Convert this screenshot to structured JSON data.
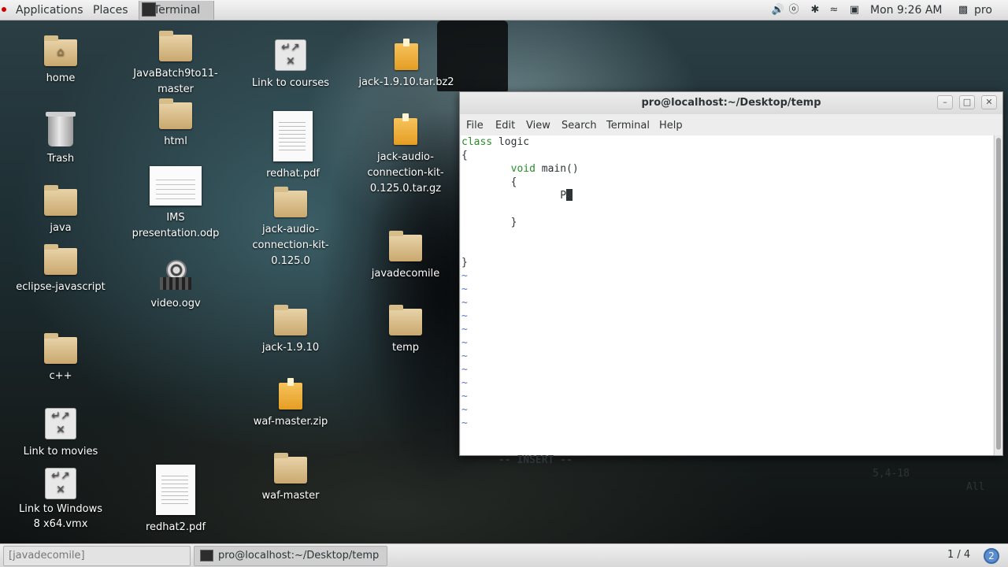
{
  "top_panel": {
    "applications": "Applications",
    "places": "Places",
    "terminal_launcher": "Terminal",
    "clock": "Mon  9:26 AM",
    "user": "pro",
    "tray_icons": [
      "volume-icon",
      "headset-icon",
      "bluetooth-icon",
      "wifi-icon",
      "clipboard-icon"
    ]
  },
  "desktop": {
    "icons": [
      {
        "label": "home",
        "type": "home-folder"
      },
      {
        "label": "Trash",
        "type": "trash"
      },
      {
        "label": "java",
        "type": "folder"
      },
      {
        "label": "eclipse-javascript",
        "type": "folder"
      },
      {
        "label": "c++",
        "type": "folder"
      },
      {
        "label": "Link to movies",
        "type": "link"
      },
      {
        "label": "Link to Windows 8 x64.vmx",
        "type": "link"
      },
      {
        "label": "JavaBatch9to11-master",
        "type": "folder"
      },
      {
        "label": "html",
        "type": "folder"
      },
      {
        "label": "IMS presentation.odp",
        "type": "presentation"
      },
      {
        "label": "video.ogv",
        "type": "video"
      },
      {
        "label": "redhat2.pdf",
        "type": "document"
      },
      {
        "label": "Link to courses",
        "type": "link"
      },
      {
        "label": "redhat.pdf",
        "type": "document"
      },
      {
        "label": "jack-audio-connection-kit-0.125.0",
        "type": "folder"
      },
      {
        "label": "jack-1.9.10",
        "type": "folder"
      },
      {
        "label": "waf-master.zip",
        "type": "archive"
      },
      {
        "label": "waf-master",
        "type": "folder"
      },
      {
        "label": "jack-1.9.10.tar.bz2",
        "type": "archive"
      },
      {
        "label": "jack-audio-connection-kit-0.125.0.tar.gz",
        "type": "archive"
      },
      {
        "label": "javadecomile",
        "type": "folder"
      },
      {
        "label": "temp",
        "type": "folder"
      }
    ]
  },
  "terminal": {
    "title": "pro@localhost:~/Desktop/temp",
    "menu": [
      "File",
      "Edit",
      "View",
      "Search",
      "Terminal",
      "Help"
    ],
    "lines": [
      {
        "keyword": "class",
        "rest": " logic"
      },
      {
        "keyword": "",
        "rest": "{"
      },
      {
        "keyword": "        void",
        "rest": " main()"
      },
      {
        "keyword": "",
        "rest": "        {"
      },
      {
        "keyword": "",
        "rest": "                P"
      },
      {
        "keyword": "",
        "rest": ""
      },
      {
        "keyword": "",
        "rest": "        }"
      },
      {
        "keyword": "",
        "rest": ""
      },
      {
        "keyword": "",
        "rest": ""
      },
      {
        "keyword": "",
        "rest": "}"
      }
    ],
    "tilde": "~",
    "tilde_count": 12,
    "status_mode": "-- INSERT --",
    "status_position": "5,4-18",
    "status_scroll": "All"
  },
  "bottom_panel": {
    "tasks": [
      "[javadecomile]",
      "pro@localhost:~/Desktop/temp"
    ],
    "workspace": "1 / 4",
    "notification_count": "2"
  }
}
